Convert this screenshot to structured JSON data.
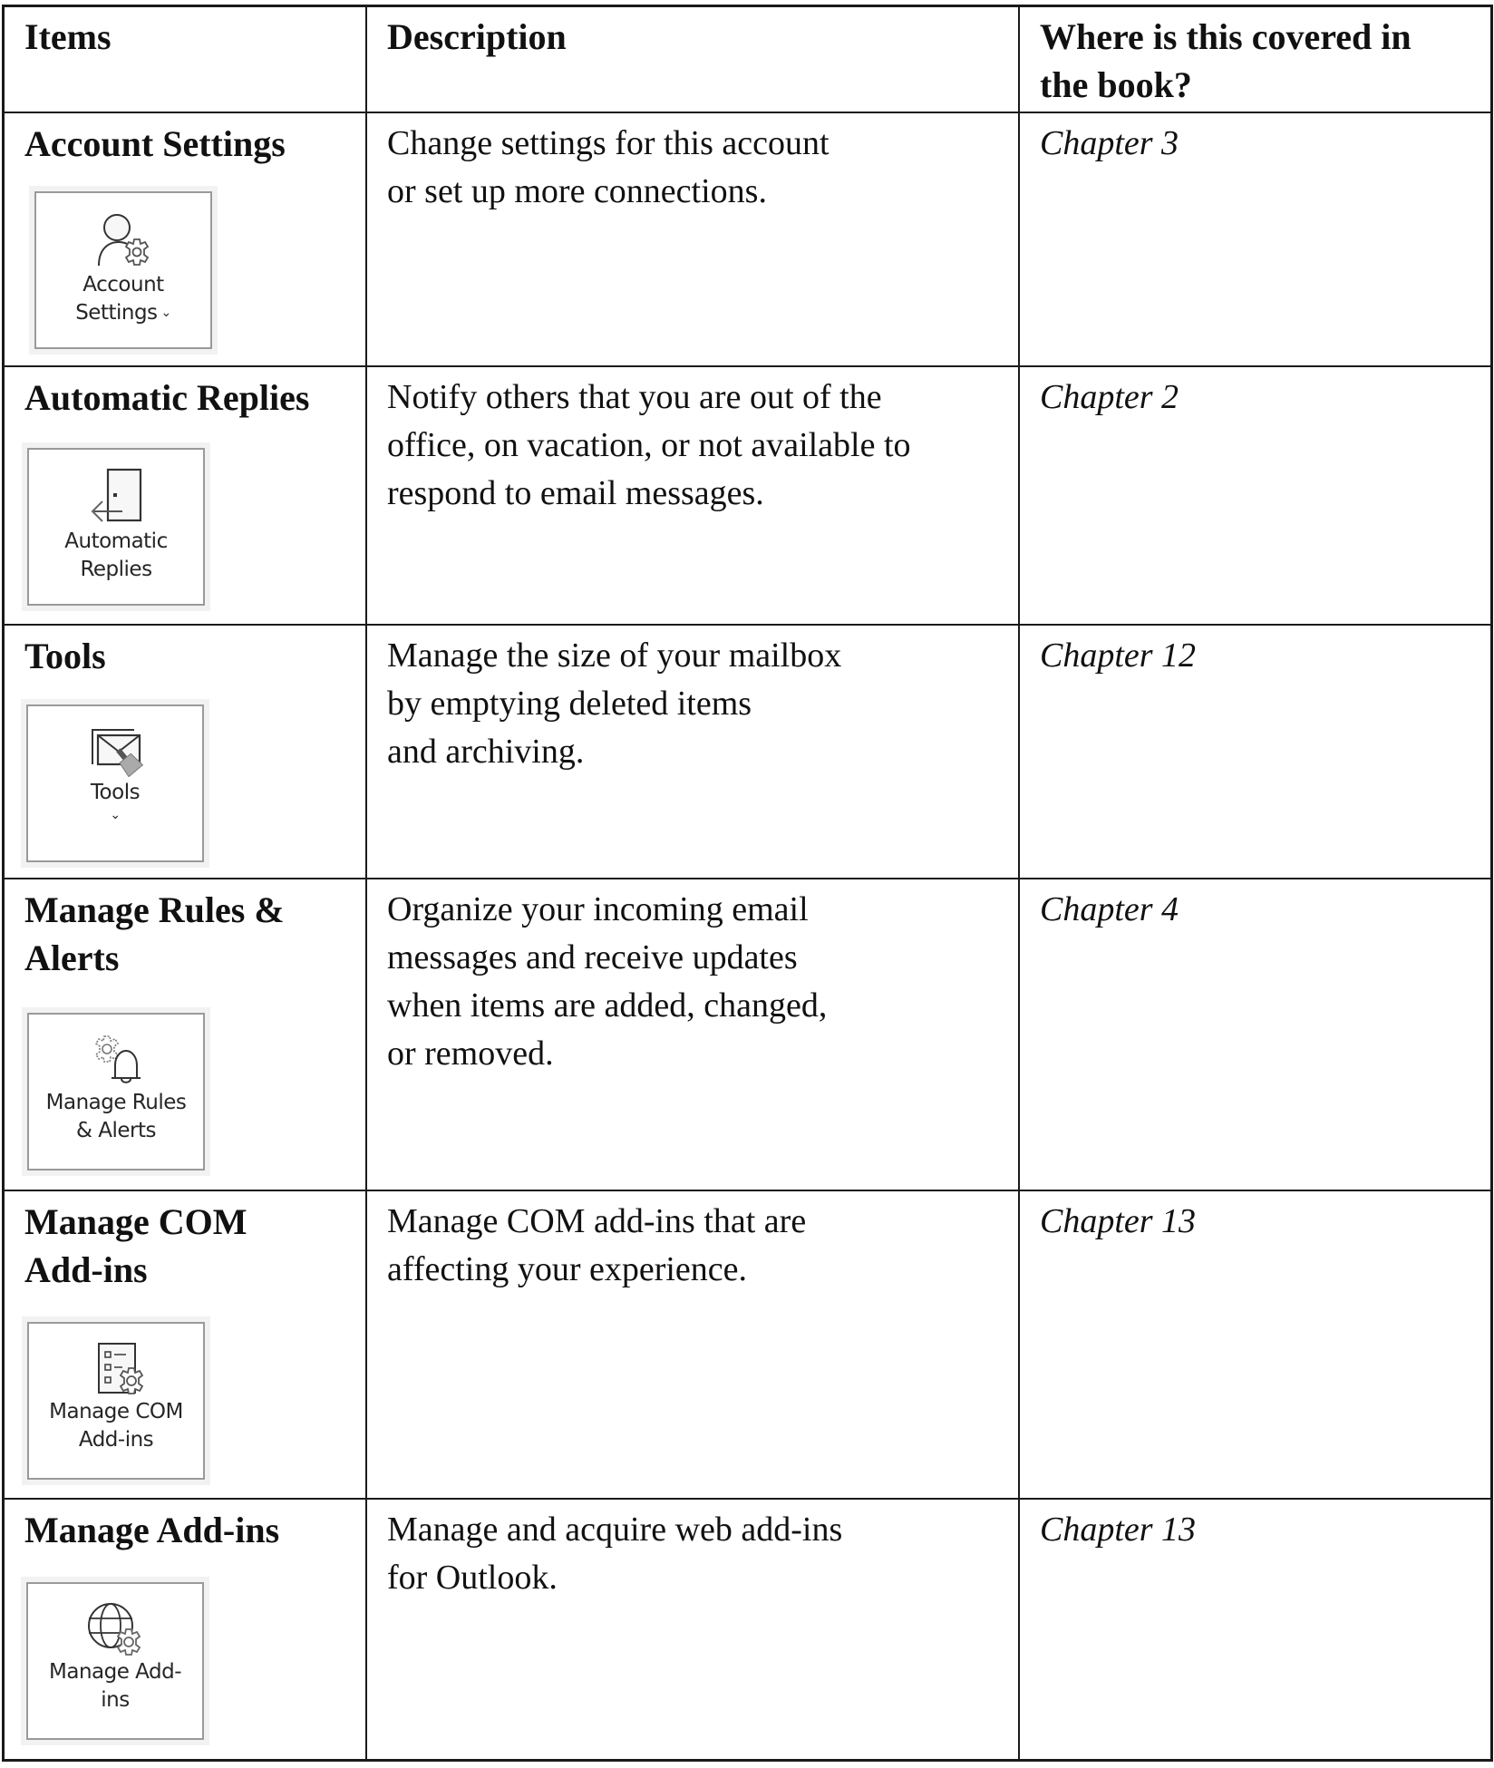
{
  "table": {
    "headers": {
      "items": "Items",
      "description": "Description",
      "where": "Where is this covered in the book?"
    },
    "rows": [
      {
        "title": "Account Settings",
        "icon": "account-settings-icon",
        "button_label": "Account\nSettings",
        "has_dropdown": true,
        "description": "Change settings for this account\nor set up more connections.",
        "chapter": "Chapter 3"
      },
      {
        "title": "Automatic Replies",
        "icon": "automatic-replies-icon",
        "button_label": "Automatic\nReplies",
        "has_dropdown": false,
        "description": "Notify others that you are out of the\noffice, on vacation, or not available to\nrespond to email messages.",
        "chapter": "Chapter 2"
      },
      {
        "title": "Tools",
        "icon": "mailbox-cleanup-icon",
        "button_label": "Tools",
        "has_dropdown": true,
        "description": "Manage the size of your mailbox\nby emptying deleted items\nand archiving.",
        "chapter": "Chapter 12"
      },
      {
        "title": "Manage Rules &\nAlerts",
        "icon": "rules-alerts-icon",
        "button_label": "Manage Rules\n& Alerts",
        "has_dropdown": false,
        "description": "Organize your incoming email\nmessages and receive updates\nwhen items are added, changed,\nor removed.",
        "chapter": "Chapter 4"
      },
      {
        "title": "Manage COM\nAdd-ins",
        "icon": "com-addins-icon",
        "button_label": "Manage COM\nAdd-ins",
        "has_dropdown": false,
        "description": "Manage COM add-ins that are\naffecting your experience.",
        "chapter": "Chapter 13"
      },
      {
        "title": "Manage Add-ins",
        "icon": "web-addins-icon",
        "button_label": "Manage Add-\nins",
        "has_dropdown": false,
        "description": "Manage and acquire web add-ins\nfor Outlook.",
        "chapter": "Chapter 13"
      }
    ],
    "dropdown_glyph": "⌄"
  }
}
